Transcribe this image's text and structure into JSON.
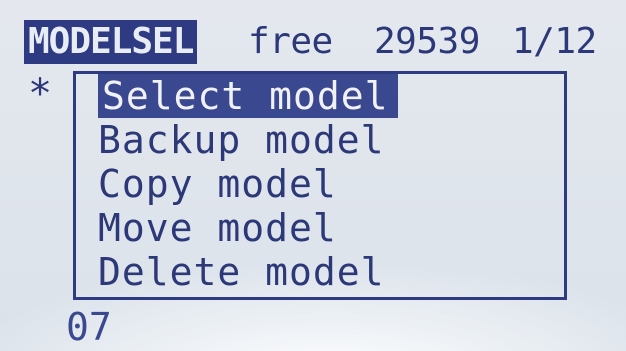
{
  "header": {
    "mode_label": "MODELSEL",
    "free_label": "free",
    "free_value": "29539",
    "page_indicator": "1/12"
  },
  "current_marker": "*",
  "menu": {
    "items": [
      {
        "label": "Select model",
        "selected": true
      },
      {
        "label": "Backup model",
        "selected": false
      },
      {
        "label": "Copy model",
        "selected": false
      },
      {
        "label": "Move model",
        "selected": false
      },
      {
        "label": "Delete model",
        "selected": false
      }
    ]
  },
  "footer": {
    "model_number": "07"
  },
  "colors": {
    "lcd_background": "#dfe5ec",
    "pixel_ink": "#2c3878",
    "highlight": "#3a4890"
  }
}
